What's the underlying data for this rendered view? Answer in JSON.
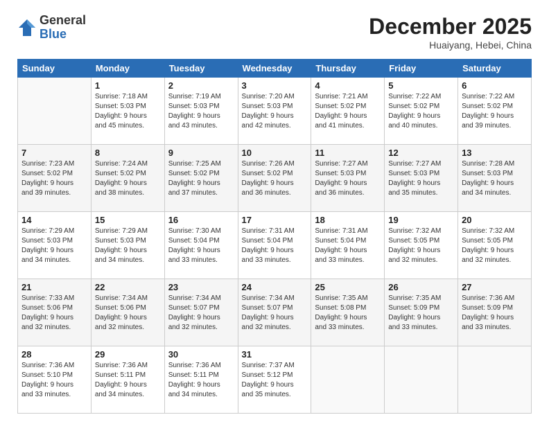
{
  "header": {
    "logo_general": "General",
    "logo_blue": "Blue",
    "month_title": "December 2025",
    "location": "Huaiyang, Hebei, China"
  },
  "weekdays": [
    "Sunday",
    "Monday",
    "Tuesday",
    "Wednesday",
    "Thursday",
    "Friday",
    "Saturday"
  ],
  "weeks": [
    [
      {
        "day": "",
        "info": ""
      },
      {
        "day": "1",
        "info": "Sunrise: 7:18 AM\nSunset: 5:03 PM\nDaylight: 9 hours\nand 45 minutes."
      },
      {
        "day": "2",
        "info": "Sunrise: 7:19 AM\nSunset: 5:03 PM\nDaylight: 9 hours\nand 43 minutes."
      },
      {
        "day": "3",
        "info": "Sunrise: 7:20 AM\nSunset: 5:03 PM\nDaylight: 9 hours\nand 42 minutes."
      },
      {
        "day": "4",
        "info": "Sunrise: 7:21 AM\nSunset: 5:02 PM\nDaylight: 9 hours\nand 41 minutes."
      },
      {
        "day": "5",
        "info": "Sunrise: 7:22 AM\nSunset: 5:02 PM\nDaylight: 9 hours\nand 40 minutes."
      },
      {
        "day": "6",
        "info": "Sunrise: 7:22 AM\nSunset: 5:02 PM\nDaylight: 9 hours\nand 39 minutes."
      }
    ],
    [
      {
        "day": "7",
        "info": "Sunrise: 7:23 AM\nSunset: 5:02 PM\nDaylight: 9 hours\nand 39 minutes."
      },
      {
        "day": "8",
        "info": "Sunrise: 7:24 AM\nSunset: 5:02 PM\nDaylight: 9 hours\nand 38 minutes."
      },
      {
        "day": "9",
        "info": "Sunrise: 7:25 AM\nSunset: 5:02 PM\nDaylight: 9 hours\nand 37 minutes."
      },
      {
        "day": "10",
        "info": "Sunrise: 7:26 AM\nSunset: 5:02 PM\nDaylight: 9 hours\nand 36 minutes."
      },
      {
        "day": "11",
        "info": "Sunrise: 7:27 AM\nSunset: 5:03 PM\nDaylight: 9 hours\nand 36 minutes."
      },
      {
        "day": "12",
        "info": "Sunrise: 7:27 AM\nSunset: 5:03 PM\nDaylight: 9 hours\nand 35 minutes."
      },
      {
        "day": "13",
        "info": "Sunrise: 7:28 AM\nSunset: 5:03 PM\nDaylight: 9 hours\nand 34 minutes."
      }
    ],
    [
      {
        "day": "14",
        "info": "Sunrise: 7:29 AM\nSunset: 5:03 PM\nDaylight: 9 hours\nand 34 minutes."
      },
      {
        "day": "15",
        "info": "Sunrise: 7:29 AM\nSunset: 5:03 PM\nDaylight: 9 hours\nand 34 minutes."
      },
      {
        "day": "16",
        "info": "Sunrise: 7:30 AM\nSunset: 5:04 PM\nDaylight: 9 hours\nand 33 minutes."
      },
      {
        "day": "17",
        "info": "Sunrise: 7:31 AM\nSunset: 5:04 PM\nDaylight: 9 hours\nand 33 minutes."
      },
      {
        "day": "18",
        "info": "Sunrise: 7:31 AM\nSunset: 5:04 PM\nDaylight: 9 hours\nand 33 minutes."
      },
      {
        "day": "19",
        "info": "Sunrise: 7:32 AM\nSunset: 5:05 PM\nDaylight: 9 hours\nand 32 minutes."
      },
      {
        "day": "20",
        "info": "Sunrise: 7:32 AM\nSunset: 5:05 PM\nDaylight: 9 hours\nand 32 minutes."
      }
    ],
    [
      {
        "day": "21",
        "info": "Sunrise: 7:33 AM\nSunset: 5:06 PM\nDaylight: 9 hours\nand 32 minutes."
      },
      {
        "day": "22",
        "info": "Sunrise: 7:34 AM\nSunset: 5:06 PM\nDaylight: 9 hours\nand 32 minutes."
      },
      {
        "day": "23",
        "info": "Sunrise: 7:34 AM\nSunset: 5:07 PM\nDaylight: 9 hours\nand 32 minutes."
      },
      {
        "day": "24",
        "info": "Sunrise: 7:34 AM\nSunset: 5:07 PM\nDaylight: 9 hours\nand 32 minutes."
      },
      {
        "day": "25",
        "info": "Sunrise: 7:35 AM\nSunset: 5:08 PM\nDaylight: 9 hours\nand 33 minutes."
      },
      {
        "day": "26",
        "info": "Sunrise: 7:35 AM\nSunset: 5:09 PM\nDaylight: 9 hours\nand 33 minutes."
      },
      {
        "day": "27",
        "info": "Sunrise: 7:36 AM\nSunset: 5:09 PM\nDaylight: 9 hours\nand 33 minutes."
      }
    ],
    [
      {
        "day": "28",
        "info": "Sunrise: 7:36 AM\nSunset: 5:10 PM\nDaylight: 9 hours\nand 33 minutes."
      },
      {
        "day": "29",
        "info": "Sunrise: 7:36 AM\nSunset: 5:11 PM\nDaylight: 9 hours\nand 34 minutes."
      },
      {
        "day": "30",
        "info": "Sunrise: 7:36 AM\nSunset: 5:11 PM\nDaylight: 9 hours\nand 34 minutes."
      },
      {
        "day": "31",
        "info": "Sunrise: 7:37 AM\nSunset: 5:12 PM\nDaylight: 9 hours\nand 35 minutes."
      },
      {
        "day": "",
        "info": ""
      },
      {
        "day": "",
        "info": ""
      },
      {
        "day": "",
        "info": ""
      }
    ]
  ]
}
